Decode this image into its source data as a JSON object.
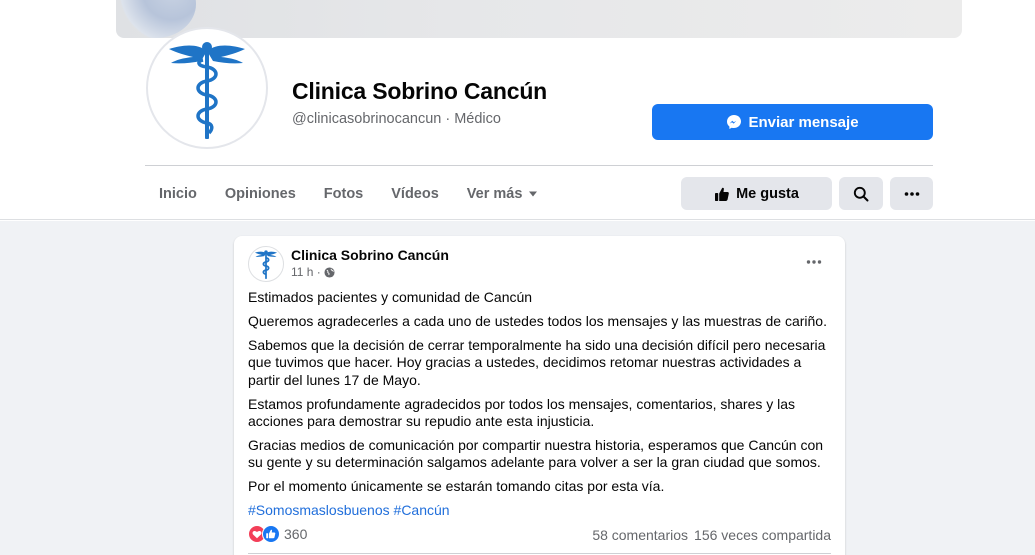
{
  "page": {
    "name": "Clinica Sobrino Cancún",
    "handle_category": "@clinicasobrinocancun · Médico",
    "send_message_label": "Enviar mensaje",
    "like_label": "Me gusta"
  },
  "nav": {
    "items": [
      {
        "label": "Inicio"
      },
      {
        "label": "Opiniones"
      },
      {
        "label": "Fotos"
      },
      {
        "label": "Vídeos"
      },
      {
        "label": "Ver más"
      }
    ]
  },
  "post": {
    "author": "Clinica Sobrino Cancún",
    "time": "11 h ·",
    "paragraphs": [
      "Estimados pacientes y comunidad de Cancún",
      "Queremos agradecerles a cada uno de ustedes todos los mensajes y las muestras de cariño.",
      "Sabemos que la decisión de cerrar temporalmente ha sido una decisión difícil pero necesaria que tuvimos que hacer. Hoy gracias a ustedes, decidimos retomar nuestras actividades a partir del lunes 17 de Mayo.",
      "Estamos profundamente agradecidos por todos los mensajes, comentarios, shares y las acciones para demostrar su repudio ante esta injusticia.",
      "Gracias medios de comunicación por compartir nuestra historia, esperamos que Cancún con su gente y su determinación salgamos adelante para volver a ser la gran ciudad que somos.",
      "Por el momento únicamente se estarán tomando citas por esta vía."
    ],
    "hashtags": [
      "#Somosmaslosbuenos",
      "#Cancún"
    ],
    "reaction_count": "360",
    "comments": "58 comentarios",
    "shares": "156 veces compartida"
  },
  "colors": {
    "accent": "#1877f2",
    "logo_blue": "#1f74c6",
    "link": "#216fdb",
    "feed_bg": "#f0f2f5"
  },
  "icons": [
    "messenger-icon",
    "thumbs-up-icon",
    "search-icon",
    "more-icon",
    "caret-down-icon",
    "globe-icon",
    "love-reaction-icon",
    "like-reaction-icon",
    "caduceus-logo"
  ]
}
